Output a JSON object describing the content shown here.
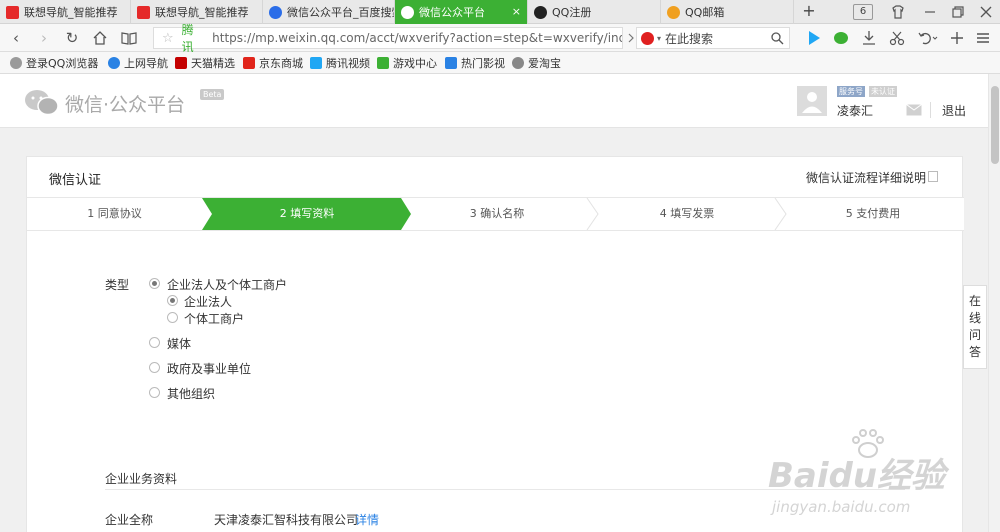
{
  "tabs": [
    {
      "label": "联想导航_智能推荐",
      "icon": "lenovo-icon",
      "color": "#e52a2a",
      "active": false
    },
    {
      "label": "联想导航_智能推荐",
      "icon": "lenovo-icon",
      "color": "#e52a2a",
      "active": false
    },
    {
      "label": "微信公众平台_百度搜索",
      "icon": "baidu-paw-icon",
      "color": "#2b6de8",
      "active": false
    },
    {
      "label": "微信公众平台",
      "icon": "wechat-icon",
      "color": "#3cb034",
      "active": true
    },
    {
      "label": "QQ注册",
      "icon": "qq-penguin-icon",
      "color": "#222222",
      "active": false
    },
    {
      "label": "QQ邮箱",
      "icon": "qq-mail-icon",
      "color": "#f0a020",
      "active": false
    }
  ],
  "tab_close": "×",
  "new_tab": "+",
  "tab_count": "6",
  "address": {
    "site": "腾讯",
    "url": "https://mp.weixin.qq.com/acct/wxverify?action=step&t=wxverify/index&"
  },
  "search": {
    "placeholder": "在此搜索"
  },
  "bookmarks": [
    {
      "label": "登录QQ浏览器",
      "icon": "user-icon",
      "color": "#9a9a9a"
    },
    {
      "label": "上网导航",
      "icon": "ie-icon",
      "color": "#2a82e4"
    },
    {
      "label": "天猫精选",
      "icon": "tmall-icon",
      "color": "#c40000"
    },
    {
      "label": "京东商城",
      "icon": "jd-icon",
      "color": "#e1251b"
    },
    {
      "label": "腾讯视频",
      "icon": "tencent-video-icon",
      "color": "#20a7f4"
    },
    {
      "label": "游戏中心",
      "icon": "gamepad-icon",
      "color": "#3cb034"
    },
    {
      "label": "热门影视",
      "icon": "play-icon",
      "color": "#2a82e4"
    },
    {
      "label": "爱淘宝",
      "icon": "taobao-icon",
      "color": "#888888"
    }
  ],
  "header": {
    "logo_text": "微信·公众平台",
    "beta": "Beta",
    "badge_service": "服务号",
    "badge_unverified": "未认证",
    "username": "凌泰汇",
    "logout": "退出"
  },
  "card": {
    "title": "微信认证",
    "help_link": "微信认证流程详细说明"
  },
  "steps": [
    {
      "label": "1 同意协议",
      "active": false
    },
    {
      "label": "2 填写资料",
      "active": true
    },
    {
      "label": "3 确认名称",
      "active": false
    },
    {
      "label": "4 填写发票",
      "active": false
    },
    {
      "label": "5 支付费用",
      "active": false
    }
  ],
  "form": {
    "type_label": "类型",
    "options": [
      {
        "label": "企业法人及个体工商户",
        "checked": true
      },
      {
        "label": "企业法人",
        "checked": true
      },
      {
        "label": "个体工商户",
        "checked": false
      },
      {
        "label": "媒体",
        "checked": false
      },
      {
        "label": "政府及事业单位",
        "checked": false
      },
      {
        "label": "其他组织",
        "checked": false
      }
    ],
    "section_title": "企业业务资料",
    "company_label": "企业全称",
    "company_name": "天津凌泰汇智科技有限公司",
    "details_link": "详情"
  },
  "online_qa": "在线问答",
  "watermark": {
    "brand": "Baidu经验",
    "url": "jingyan.baidu.com"
  },
  "colors": {
    "accent": "#3cb034",
    "link": "#2a82e4"
  }
}
